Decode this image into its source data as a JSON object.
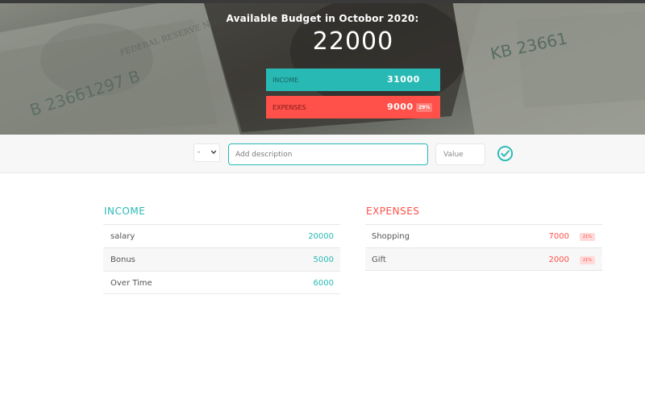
{
  "budget": {
    "title": "Available Budget in Octobor 2020:",
    "value": "22000",
    "income_label": "Income",
    "income_value": "31000",
    "expenses_label": "Expenses",
    "expenses_value": "9000",
    "expenses_percentage": "29%"
  },
  "add_form": {
    "type_value": "-",
    "description_placeholder": "Add description",
    "value_placeholder": "Value"
  },
  "income": {
    "title": "Income",
    "items": [
      {
        "description": "salary",
        "value": "20000"
      },
      {
        "description": "Bonus",
        "value": "5000"
      },
      {
        "description": "Over Time",
        "value": "6000"
      }
    ]
  },
  "expenses": {
    "title": "Expenses",
    "items": [
      {
        "description": "Shopping",
        "value": "7000",
        "percentage": "21%"
      },
      {
        "description": "Gift",
        "value": "2000",
        "percentage": "21%"
      }
    ]
  },
  "colors": {
    "income": "#28b9b5",
    "expense": "#ff5049"
  },
  "icons": {
    "add_button": "check-circle-icon",
    "type_select": "chevron-down-icon"
  }
}
